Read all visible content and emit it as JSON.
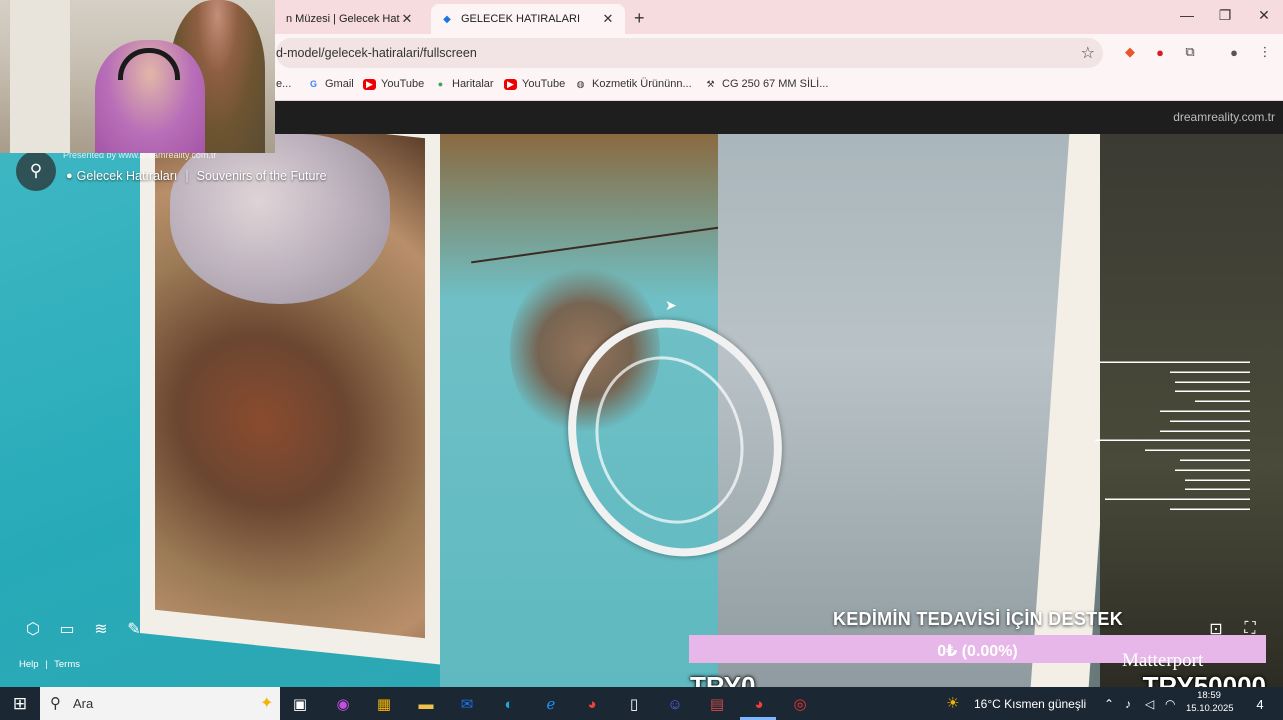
{
  "browser": {
    "tabs": [
      {
        "title": "n Müzesi | Gelecek Hatıraları",
        "active": false
      },
      {
        "title": "GELECEK HATIRALARI",
        "active": true
      }
    ],
    "new_tab": "+",
    "window_controls": {
      "minimize": "—",
      "maximize": "❐",
      "close": "✕"
    },
    "url": "d-model/gelecek-hatiralari/fullscreen",
    "bookmarks": [
      {
        "label": "e...",
        "icon": "page-icon"
      },
      {
        "label": "Gmail",
        "icon": "google-icon"
      },
      {
        "label": "YouTube",
        "icon": "youtube-icon"
      },
      {
        "label": "Haritalar",
        "icon": "maps-icon"
      },
      {
        "label": "YouTube",
        "icon": "youtube-icon"
      },
      {
        "label": "Kozmetik Ürününn...",
        "icon": "globe-icon"
      },
      {
        "label": "CG 250 67 MM SİLİ...",
        "icon": "tool-icon"
      }
    ]
  },
  "viewer": {
    "site": "dreamreality.com.tr",
    "presented_by": "Presented by www.dreamreality.com.tr",
    "model_name": "Gelecek Hatıraları",
    "model_subtitle": "Souvenirs of the Future",
    "help": "Help",
    "help_sep": "|",
    "terms": "Terms",
    "logo": "Matterport"
  },
  "donation": {
    "title": "KEDİMİN TEDAVİSİ İÇİN DESTEK",
    "progress_text": "0₺ (0.00%)",
    "progress_fraction": 0.0,
    "current": "TRY0",
    "goal": "TRY50000"
  },
  "taskbar": {
    "search_placeholder": "Ara",
    "weather": "16°C  Kısmen güneşli",
    "time": "18:59",
    "date": "15.10.2025",
    "notifications": "4"
  },
  "colors": {
    "tabstrip": "#f7dcdf",
    "toolbar": "#fdf4f5",
    "donation_bar": "#e6b7e8",
    "taskbar": "#1b2733"
  }
}
